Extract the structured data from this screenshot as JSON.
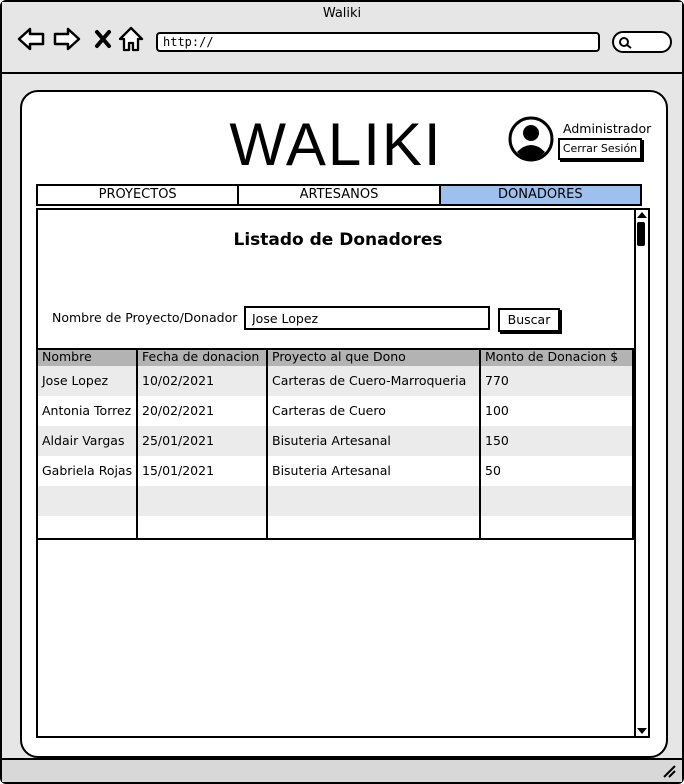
{
  "window": {
    "title": "Waliki"
  },
  "browser": {
    "url": "http://"
  },
  "header": {
    "logo": "WALIKI",
    "user_role": "Administrador",
    "logout_label": "Cerrar Sesión"
  },
  "tabs": [
    {
      "label": "PROYECTOS",
      "active": false
    },
    {
      "label": "ARTESANOS",
      "active": false
    },
    {
      "label": "DONADORES",
      "active": true
    }
  ],
  "main": {
    "title": "Listado de Donadores",
    "filter": {
      "label": "Nombre de Proyecto/Donador",
      "value": "Jose Lopez",
      "button_label": "Buscar"
    },
    "table": {
      "columns": [
        "Nombre",
        "Fecha de donacion",
        "Proyecto al que Dono",
        "Monto de Donacion $"
      ],
      "rows": [
        [
          "Jose Lopez",
          "10/02/2021",
          "Carteras de Cuero-Marroqueria",
          "770"
        ],
        [
          "Antonia Torrez",
          "20/02/2021",
          "Carteras de Cuero",
          "100"
        ],
        [
          "Aldair Vargas",
          "25/01/2021",
          "Bisuteria Artesanal",
          "150"
        ],
        [
          "Gabriela Rojas",
          "15/01/2021",
          "Bisuteria Artesanal",
          "50"
        ],
        [
          "",
          "",
          "",
          ""
        ],
        [
          "",
          "",
          "",
          ""
        ]
      ]
    }
  },
  "colors": {
    "active_tab": "#9ec0ee",
    "header_row": "#b3b3b3",
    "shaded_row": "#ebebeb"
  }
}
